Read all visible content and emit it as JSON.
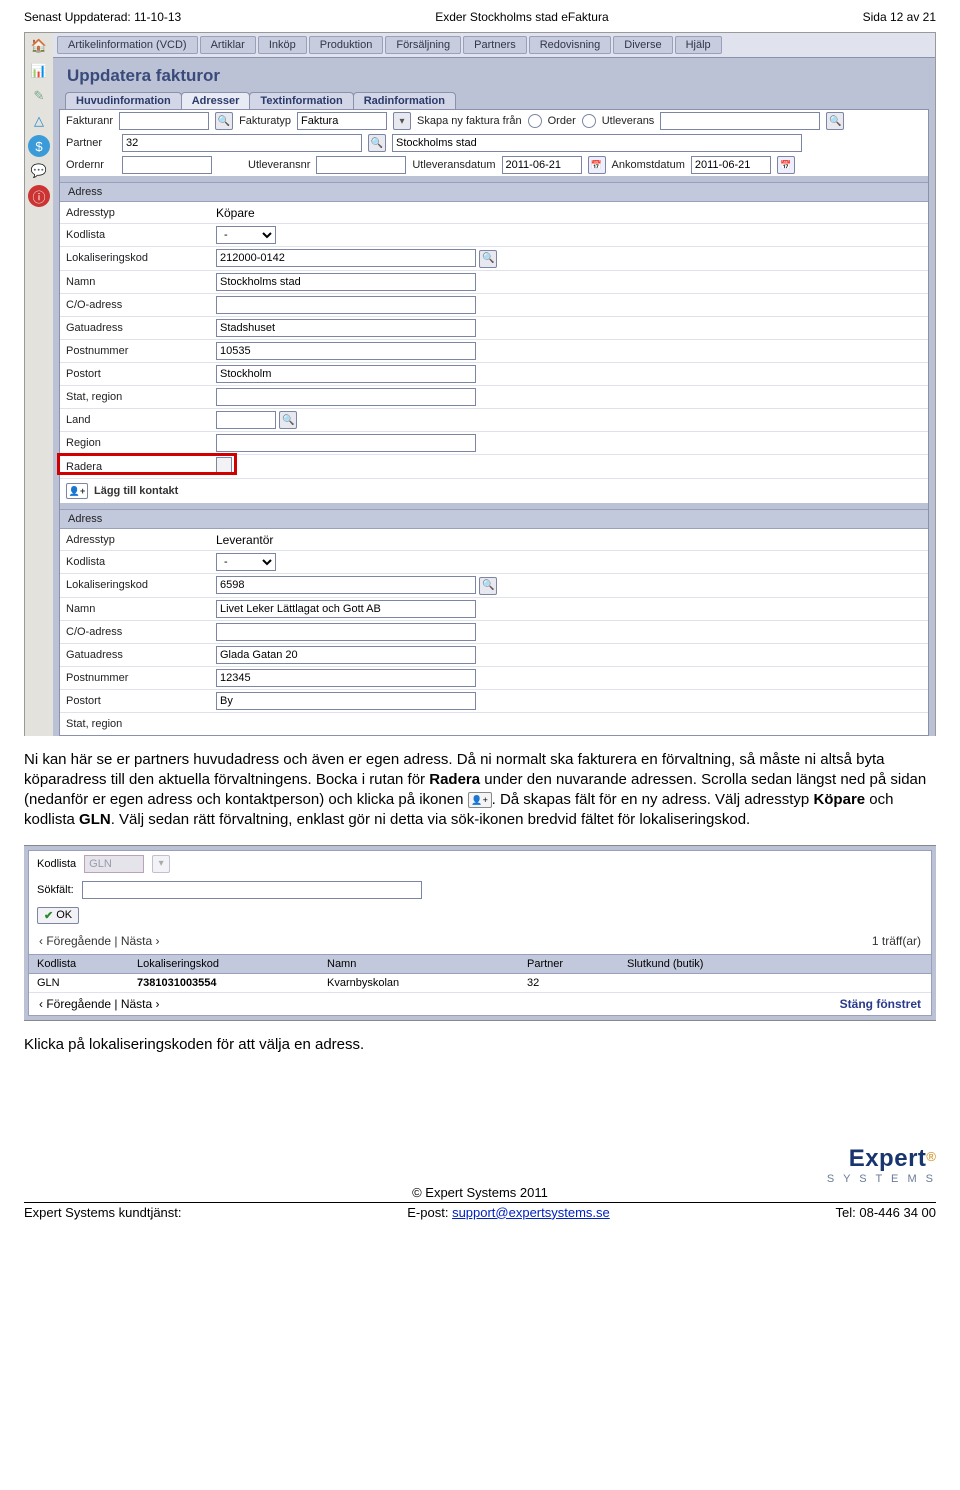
{
  "header": {
    "left": "Senast Uppdaterad: 11-10-13",
    "center": "Exder Stockholms stad eFaktura",
    "right": "Sida 12 av 21"
  },
  "side_icons": [
    "🏠",
    "📊",
    "✎",
    "△",
    "$",
    "💬",
    "ⓘ"
  ],
  "topmenu": [
    "Artikelinformation (VCD)",
    "Artiklar",
    "Inköp",
    "Produktion",
    "Försäljning",
    "Partners",
    "Redovisning",
    "Diverse",
    "Hjälp"
  ],
  "title": "Uppdatera fakturor",
  "tabs": [
    "Huvudinformation",
    "Adresser",
    "Textinformation",
    "Radinformation"
  ],
  "form": {
    "fakturanr_lbl": "Fakturanr",
    "fakturatyp_lbl": "Fakturatyp",
    "fakturatyp_val": "Faktura",
    "skapa_lbl": "Skapa ny faktura från",
    "order_lbl": "Order",
    "utlev_lbl": "Utleverans",
    "partner_lbl": "Partner",
    "partner_val": "32",
    "partner_name": "Stockholms stad",
    "ordernr_lbl": "Ordernr",
    "utleveransnr_lbl": "Utleveransnr",
    "utlev_date_lbl": "Utleveransdatum",
    "utlev_date": "2011-06-21",
    "ankomst_lbl": "Ankomstdatum",
    "ankomst_date": "2011-06-21"
  },
  "addr_section_hdr": "Adress",
  "addr1": {
    "Adresstyp": "Köpare",
    "Kodlista": "-",
    "Lokaliseringskod": "212000-0142",
    "Namn": "Stockholms stad",
    "C/O-adress": "",
    "Gatuadress": "Stadshuset",
    "Postnummer": "10535",
    "Postort": "Stockholm",
    "Stat, region": "",
    "Land": "",
    "Region": "",
    "Radera": ""
  },
  "add_contact": "Lägg till kontakt",
  "addr2": {
    "Adresstyp": "Leverantör",
    "Kodlista": "-",
    "Lokaliseringskod": "6598",
    "Namn": "Livet Leker Lättlagat och Gott AB",
    "C/O-adress": "",
    "Gatuadress": "Glada Gatan 20",
    "Postnummer": "12345",
    "Postort": "By",
    "Stat, region": ""
  },
  "body": {
    "p1a": "Ni kan här se er partners huvudadress och även er egen adress. Då ni normalt ska fakturera en förvaltning, så måste ni altså byta köparadress till den aktuella förvaltningens. Bocka i rutan för ",
    "p1b": "Radera",
    "p1c": " under den nuvarande adressen. Scrolla sedan längst ned på sidan (nedanför er egen adress och kontaktperson) och klicka på ikonen ",
    "p1d": ". Då skapas fält för en ny adress. Välj adresstyp ",
    "p1e": "Köpare",
    "p1f": " och kodlista ",
    "p1g": "GLN",
    "p1h": ". Välj sedan rätt förvaltning, enklast gör ni detta via sök-ikonen bredvid fältet för lokaliseringskod.",
    "p2": "Klicka på lokaliseringskoden för att välja en adress."
  },
  "search": {
    "kodlista_lbl": "Kodlista",
    "kodlista_val": "GLN",
    "sokfalt_lbl": "Sökfält:",
    "ok": "OK",
    "prev": "‹ Föregående",
    "pipe": " | ",
    "next": "Nästa ›",
    "hits": "1 träff(ar)",
    "cols": {
      "c1": "Kodlista",
      "c2": "Lokaliseringskod",
      "c3": "Namn",
      "c4": "Partner",
      "c5": "Slutkund (butik)"
    },
    "row": {
      "c1": "GLN",
      "c2": "7381031003554",
      "c3": "Kvarnbyskolan",
      "c4": "32",
      "c5": ""
    },
    "close": "Stäng fönstret"
  },
  "footer": {
    "logo_name": "Expert",
    "logo_reg": "®",
    "logo_sub": "S Y S T E M S",
    "copyright": "© Expert Systems 2011",
    "left": "Expert Systems kundtjänst:",
    "center_lbl": "E-post: ",
    "center_link": "support@expertsystems.se",
    "right": "Tel: 08-446 34 00"
  }
}
